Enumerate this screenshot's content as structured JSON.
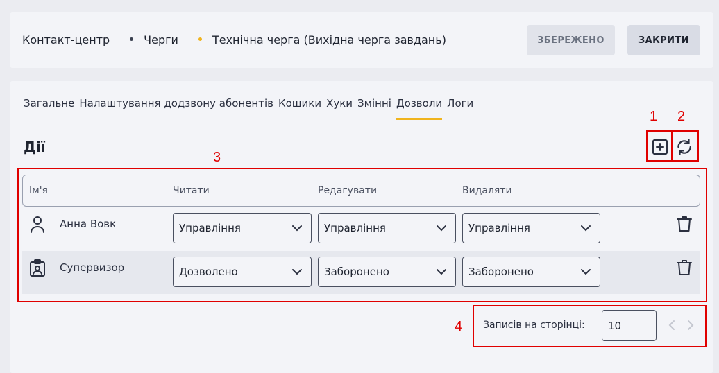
{
  "breadcrumb": {
    "items": [
      "Контакт-центр",
      "Черги",
      "Технічна черга (Вихідна черга завдань)"
    ],
    "dot_colors": [
      "#3a4050",
      "#f0b41e"
    ]
  },
  "header": {
    "saved_label": "ЗБЕРЕЖЕНО",
    "close_label": "ЗАКРИТИ"
  },
  "tabs": [
    {
      "label": "Загальне",
      "active": false
    },
    {
      "label": "Налаштування додзвону абонентів",
      "active": false
    },
    {
      "label": "Кошики",
      "active": false
    },
    {
      "label": "Хуки",
      "active": false
    },
    {
      "label": "Змінні",
      "active": false
    },
    {
      "label": "Дозволи",
      "active": true
    },
    {
      "label": "Логи",
      "active": false
    }
  ],
  "section": {
    "title": "Дії",
    "add_icon": "plus-square-icon",
    "refresh_icon": "refresh-icon"
  },
  "table": {
    "columns": [
      "Ім'я",
      "Читати",
      "Редагувати",
      "Видаляти"
    ],
    "rows": [
      {
        "icon": "user-icon",
        "name": "Анна Вовк",
        "read": "Управління",
        "edit": "Управління",
        "delete": "Управління"
      },
      {
        "icon": "badge-icon",
        "name": "Супервизор",
        "read": "Дозволено",
        "edit": "Заборонено",
        "delete": "Заборонено"
      }
    ]
  },
  "pagination": {
    "label": "Записів на сторінці:",
    "per_page": "10"
  },
  "annotations": {
    "labels": [
      "1",
      "2",
      "3",
      "4"
    ],
    "color": "#e00000"
  },
  "colors": {
    "accent": "#f0b41e",
    "background": "#ebecf1",
    "panel": "#f3f4f8"
  }
}
